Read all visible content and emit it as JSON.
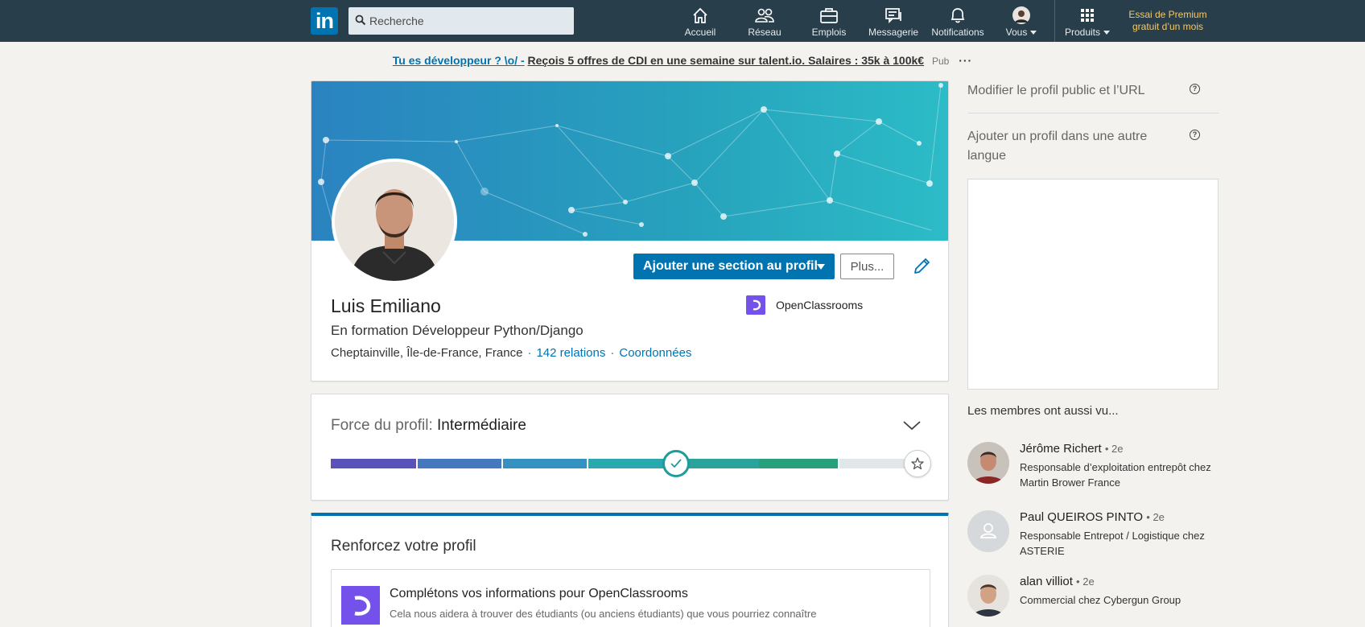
{
  "nav": {
    "search_placeholder": "Recherche",
    "items": [
      {
        "label": "Accueil",
        "icon": "home-icon"
      },
      {
        "label": "Réseau",
        "icon": "network-icon"
      },
      {
        "label": "Emplois",
        "icon": "briefcase-icon"
      },
      {
        "label": "Messagerie",
        "icon": "messaging-icon"
      },
      {
        "label": "Notifications",
        "icon": "bell-icon"
      },
      {
        "label": "Vous",
        "icon": "avatar"
      }
    ],
    "products_label": "Produits",
    "premium_line1": "Essai de Premium",
    "premium_line2": "gratuit d’un mois"
  },
  "ad": {
    "link": "Tu es développeur ? \\o/ -",
    "text": "Reçois 5 offres de CDI en une semaine sur talent.io. Salaires : 35k à 100k€",
    "pub": "Pub",
    "more": "···"
  },
  "profile": {
    "name": "Luis Emiliano",
    "headline": "En formation Développeur Python/Django",
    "location": "Cheptainville, Île-de-France, France",
    "relations": "142 relations",
    "contact": "Coordonnées",
    "company": "OpenClassrooms",
    "add_section_button": "Ajouter une section au profil",
    "more_button": "Plus..."
  },
  "strength": {
    "label": "Force du profil:",
    "level": "Intermédiaire",
    "progress_fraction": 0.6
  },
  "renforcez": {
    "title": "Renforcez votre profil",
    "item_title": "Complétons vos informations pour OpenClassrooms",
    "item_text": "Cela nous aidera à trouver des étudiants (ou anciens étudiants) que vous pourriez connaître"
  },
  "rail": {
    "public_profile": "Modifier le profil public et l’URL",
    "other_language_1": "Ajouter un profil dans une autre",
    "other_language_2": "langue",
    "also_viewed": "Les membres ont aussi vu...",
    "people": [
      {
        "name": "Jérôme Richert",
        "degree": "• 2e",
        "title": "Responsable d’exploitation entrepôt chez Martin Brower France"
      },
      {
        "name": "Paul QUEIROS PINTO",
        "degree": "• 2e",
        "title": "Responsable Entrepot / Logistique chez ASTERIE"
      },
      {
        "name": "alan villiot",
        "degree": "• 2e",
        "title": "Commercial chez Cybergun Group"
      }
    ]
  },
  "colors": {
    "nav_bg": "#283e4a",
    "primary": "#0073b1",
    "oc_purple": "#7451eb",
    "premium": "#f5c96b"
  }
}
